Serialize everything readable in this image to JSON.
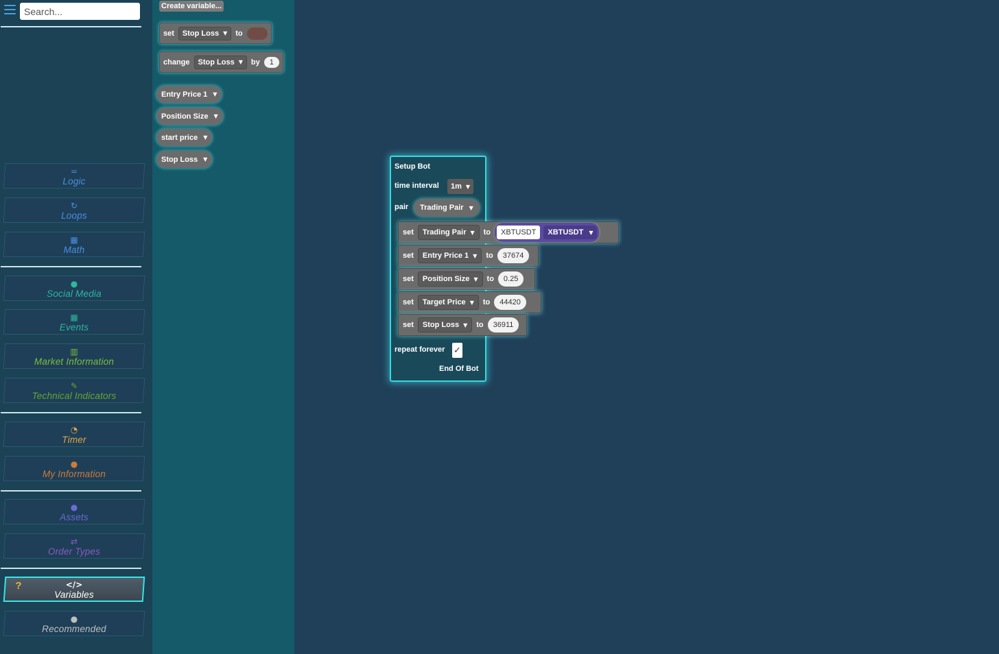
{
  "search": {
    "placeholder": "Search..."
  },
  "categories": [
    {
      "label": "Logic",
      "icon": "equals-icon",
      "glyph": "=",
      "color": "#4a8fe0"
    },
    {
      "label": "Loops",
      "icon": "loop-icon",
      "glyph": "↻",
      "color": "#4a8fe0"
    },
    {
      "label": "Math",
      "icon": "calculator-icon",
      "glyph": "▦",
      "color": "#4a8fe0"
    },
    {
      "label": "Social Media",
      "icon": "chat-icon",
      "glyph": "●",
      "color": "#2fb5a0"
    },
    {
      "label": "Events",
      "icon": "calendar-icon",
      "glyph": "▦",
      "color": "#2fb5a0"
    },
    {
      "label": "Market Information",
      "icon": "chart-icon",
      "glyph": "▥",
      "color": "#7cbf3c"
    },
    {
      "label": "Technical Indicators",
      "icon": "wrench-icon",
      "glyph": "✎",
      "color": "#6aa334"
    },
    {
      "label": "Timer",
      "icon": "stopwatch-icon",
      "glyph": "◔",
      "color": "#e0a84a"
    },
    {
      "label": "My Information",
      "icon": "user-icon",
      "glyph": "●",
      "color": "#d07a3a"
    },
    {
      "label": "Assets",
      "icon": "bitcoin-icon",
      "glyph": "●",
      "color": "#6a6ad8"
    },
    {
      "label": "Order Types",
      "icon": "exchange-icon",
      "glyph": "⇄",
      "color": "#8a5ac0"
    },
    {
      "label": "Variables",
      "icon": "code-icon",
      "glyph": "</>",
      "color": "#ffffff"
    },
    {
      "label": "Recommended",
      "icon": "lightbulb-icon",
      "glyph": "●",
      "color": "#bfbfbf"
    }
  ],
  "flyout": {
    "create_variable": "Create variable...",
    "set_block": {
      "keyword": "set",
      "variable": "Stop Loss",
      "to": "to"
    },
    "change_block": {
      "keyword": "change",
      "variable": "Stop Loss",
      "by": "by",
      "value": "1"
    },
    "variables": [
      "Entry Price 1",
      "Position Size",
      "start price",
      "Stop Loss"
    ]
  },
  "setup_bot": {
    "title": "Setup Bot",
    "interval_label": "time interval",
    "interval_value": "1m",
    "pair_label": "pair",
    "pair_value": "Trading Pair",
    "set_rows": [
      {
        "keyword": "set",
        "variable": "Trading Pair",
        "to": "to",
        "value": "XBTUSDT",
        "dropdown": "XBTUSDT"
      },
      {
        "keyword": "set",
        "variable": "Entry Price 1",
        "to": "to",
        "value": "37674"
      },
      {
        "keyword": "set",
        "variable": "Position Size",
        "to": "to",
        "value": "0.25"
      },
      {
        "keyword": "set",
        "variable": "Target Price",
        "to": "to",
        "value": "44420"
      },
      {
        "keyword": "set",
        "variable": "Stop Loss",
        "to": "to",
        "value": "36911"
      }
    ],
    "repeat_label": "repeat forever",
    "repeat_checked": "✓",
    "end_label": "End Of Bot"
  },
  "colors": {
    "accent": "#36e5e5",
    "workspace": "#20405a",
    "flyout": "#145a69",
    "sidebar": "#1b4255"
  }
}
